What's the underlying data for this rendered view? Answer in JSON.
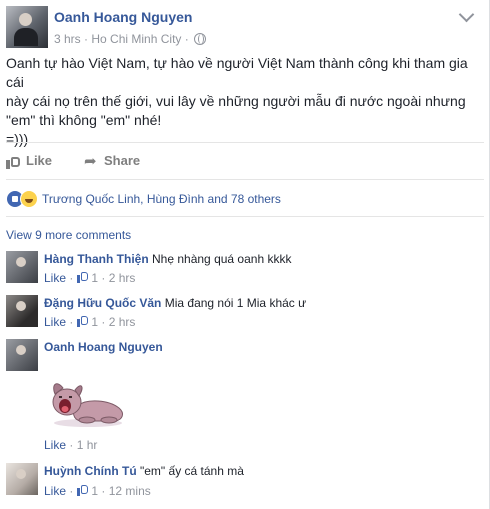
{
  "post": {
    "author": "Oanh Hoang Nguyen",
    "time": "3 hrs",
    "location": "Ho Chi Minh City",
    "separator": "·",
    "text": "Oanh tự hào Việt Nam, tự hào về người Việt Nam thành công khi tham gia cái\nnày cái nọ trên thế giới, vui lây về những người mẫu đi nước ngoài nhưng\n\"em\" thì không \"em\" nhé!\n=)))"
  },
  "actions": {
    "like_label": "Like",
    "share_label": "Share"
  },
  "reactions": {
    "summary": "Trương Quốc Linh, Hùng Đình and 78 others"
  },
  "comments_link": "View 9 more comments",
  "comments": [
    {
      "name": "Hàng Thanh Thiện",
      "text": "Nhẹ nhàng quá oanh kkkk",
      "like": "Like",
      "likes": "1",
      "time": "2 hrs"
    },
    {
      "name": "Đặng Hữu Quốc Văn",
      "text": "Mia đang nói 1 Mia khác ư",
      "like": "Like",
      "likes": "1",
      "time": "2 hrs"
    },
    {
      "name": "Oanh Hoang Nguyen",
      "text": "",
      "like": "Like",
      "likes": "",
      "time": "1 hr"
    },
    {
      "name": "Huỳnh Chính Tú",
      "text": "\"em\" ấy cá tánh mà",
      "like": "Like",
      "likes": "1",
      "time": "12 mins"
    }
  ],
  "colors": {
    "link": "#365899",
    "meta": "#90949c",
    "like_blue": "#4267b2",
    "haha_yellow": "#fcd24d"
  },
  "icons": [
    "globe-icon",
    "chevron-down-icon",
    "thumbs-up-icon",
    "share-icon",
    "reaction-like-icon",
    "reaction-haha-icon",
    "dog-sticker"
  ]
}
